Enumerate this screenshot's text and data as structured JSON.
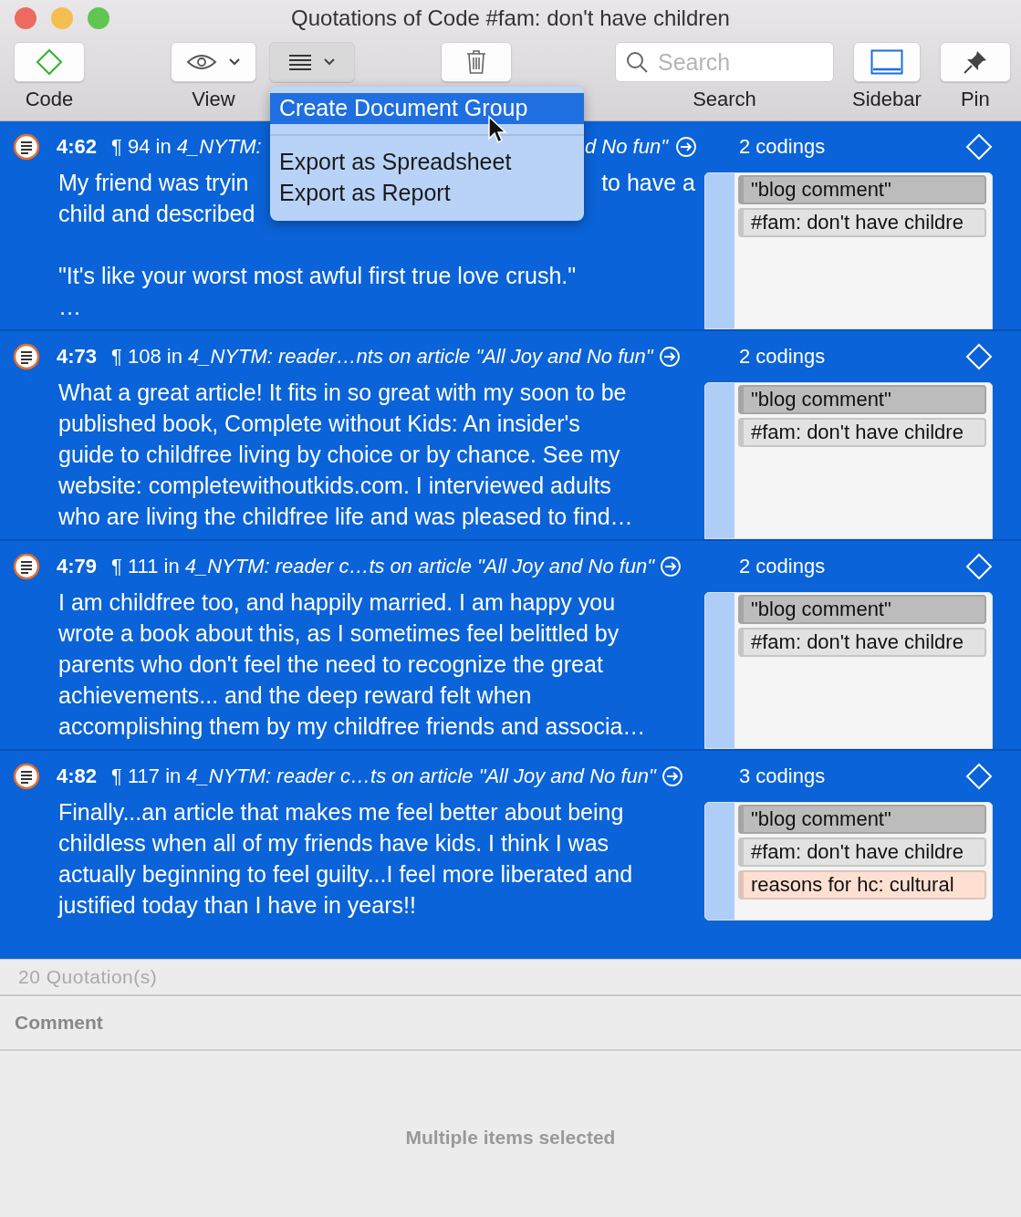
{
  "window": {
    "title": "Quotations of Code #fam: don't have children"
  },
  "toolbar": {
    "items": [
      {
        "kind": "code",
        "label": "Code"
      },
      {
        "kind": "view",
        "label": "View"
      },
      {
        "kind": "actions",
        "pressed": true
      },
      {
        "kind": "trash"
      },
      {
        "kind": "search",
        "placeholder": "Search",
        "label": "Search"
      },
      {
        "kind": "sidebar",
        "label": "Sidebar"
      },
      {
        "kind": "pin",
        "label": "Pin"
      }
    ]
  },
  "menu": {
    "items": [
      {
        "kind": "item",
        "label": "Create Document Group",
        "selected": true
      },
      {
        "kind": "separator"
      },
      {
        "kind": "item",
        "label": "Export as Spreadsheet",
        "selected": false
      },
      {
        "kind": "item",
        "label": "Export as Report",
        "selected": false
      }
    ]
  },
  "rows": [
    {
      "id": "4:62",
      "paragraph": "¶ 94 in",
      "source": "4_NYTM:",
      "source_tail": "d No fun\"",
      "selected": true,
      "lines": [
        {
          "parts": [
            "My friend was tryin",
            "to have a"
          ]
        },
        {
          "parts": [
            "child and described"
          ]
        },
        {
          "parts": [
            "\"It's like your worst most awful first true love crush.\""
          ],
          "space_before": true
        },
        {
          "parts": [
            "…"
          ]
        }
      ],
      "codings_count": "2 codings",
      "codings": [
        {
          "label": "\"blog comment\"",
          "color": "#bcbcbc"
        },
        {
          "label": "#fam: don't have childre",
          "color": "#e2e2e2"
        }
      ]
    },
    {
      "id": "4:73",
      "paragraph": "¶ 108 in",
      "source": "4_NYTM: reader…nts on article \"All Joy and No fun\"",
      "selected": true,
      "lines": [
        {
          "parts": [
            "What a great article! It fits in so great with my soon to be"
          ]
        },
        {
          "parts": [
            "published book, Complete without Kids: An insider's"
          ]
        },
        {
          "parts": [
            "guide to childfree living by choice or by chance. See my"
          ]
        },
        {
          "parts": [
            "website: completewithoutkids.com. I interviewed adults"
          ]
        },
        {
          "parts": [
            "who are living the childfree life and was pleased to find…"
          ]
        }
      ],
      "codings_count": "2 codings",
      "codings": [
        {
          "label": "\"blog comment\"",
          "color": "#bcbcbc"
        },
        {
          "label": "#fam: don't have childre",
          "color": "#e2e2e2"
        }
      ]
    },
    {
      "id": "4:79",
      "paragraph": "¶ 111 in",
      "source": "4_NYTM: reader c…ts on article \"All Joy and No fun\"",
      "selected": true,
      "lines": [
        {
          "parts": [
            "I am childfree too, and happily married. I am happy you"
          ]
        },
        {
          "parts": [
            "wrote a book about this, as I sometimes feel belittled by"
          ]
        },
        {
          "parts": [
            "parents who don't feel the need to recognize the great"
          ]
        },
        {
          "parts": [
            "achievements... and the deep reward felt when"
          ]
        },
        {
          "parts": [
            "accomplishing them by my childfree friends and associa…"
          ]
        }
      ],
      "codings_count": "2 codings",
      "codings": [
        {
          "label": "\"blog comment\"",
          "color": "#bcbcbc"
        },
        {
          "label": "#fam: don't have childre",
          "color": "#e2e2e2"
        }
      ]
    },
    {
      "id": "4:82",
      "paragraph": "¶ 117 in",
      "source": "4_NYTM: reader c…ts on article \"All Joy and No fun\"",
      "selected": true,
      "lines": [
        {
          "parts": [
            "Finally...an article that makes me feel better about being"
          ]
        },
        {
          "parts": [
            "childless when all of my friends have kids. I think I was"
          ]
        },
        {
          "parts": [
            "actually beginning to feel guilty...I feel more liberated and"
          ]
        },
        {
          "parts": [
            "justified today than I have in years!!"
          ]
        }
      ],
      "codings_count": "3 codings",
      "codings": [
        {
          "label": "\"blog comment\"",
          "color": "#bcbcbc"
        },
        {
          "label": "#fam: don't have childre",
          "color": "#e2e2e2"
        },
        {
          "label": "reasons for hc: cultural",
          "color": "#fde0d2"
        }
      ]
    }
  ],
  "status": {
    "count": "20 Quotation(s)"
  },
  "comment": {
    "title": "Comment",
    "empty_text": "Multiple items selected"
  }
}
